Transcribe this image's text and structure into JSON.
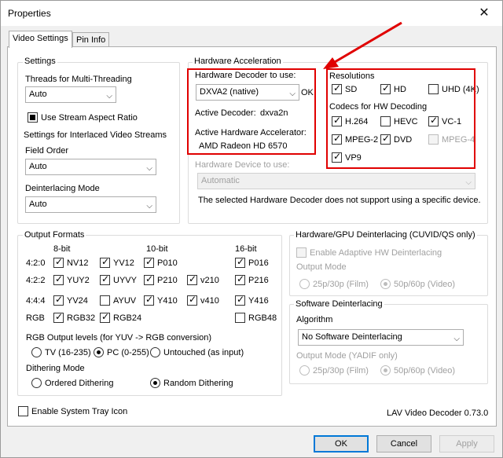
{
  "window": {
    "title": "Properties",
    "close_glyph": "✕"
  },
  "tabs": [
    "Video Settings",
    "Pin Info"
  ],
  "settings": {
    "group_label": "Settings",
    "threads_label": "Threads for Multi-Threading",
    "threads_value": "Auto",
    "stream_aspect_label": "Use Stream Aspect Ratio",
    "stream_aspect_state": "indeterminate",
    "interlaced_label": "Settings for Interlaced Video Streams",
    "field_order_label": "Field Order",
    "field_order_value": "Auto",
    "deint_mode_label": "Deinterlacing Mode",
    "deint_mode_value": "Auto"
  },
  "hwaccel": {
    "group_label": "Hardware Acceleration",
    "decoder_label": "Hardware Decoder to use:",
    "decoder_value": "DXVA2 (native)",
    "ok_label": "OK",
    "active_decoder_label": "Active Decoder:",
    "active_decoder_value": "dxva2n",
    "active_accel_label": "Active Hardware Accelerator:",
    "active_accel_value": "AMD Radeon HD 6570",
    "device_label": "Hardware Device to use:",
    "device_value": "Automatic",
    "device_note": "The selected Hardware Decoder does not support using a specific device.",
    "resolutions_label": "Resolutions",
    "resolutions": [
      {
        "label": "SD",
        "checked": true
      },
      {
        "label": "HD",
        "checked": true
      },
      {
        "label": "UHD (4K)",
        "checked": false
      }
    ],
    "codecs_label": "Codecs for HW Decoding",
    "codecs": [
      {
        "label": "H.264",
        "checked": true
      },
      {
        "label": "HEVC",
        "checked": false
      },
      {
        "label": "VC-1",
        "checked": true
      },
      {
        "label": "MPEG-2",
        "checked": true
      },
      {
        "label": "DVD",
        "checked": true
      },
      {
        "label": "MPEG-4",
        "checked": false,
        "disabled": true
      },
      {
        "label": "VP9",
        "checked": true
      }
    ]
  },
  "output_formats": {
    "group_label": "Output Formats",
    "col_8bit": "8-bit",
    "col_10bit": "10-bit",
    "col_16bit": "16-bit",
    "row_420": "4:2:0",
    "row_422": "4:2:2",
    "row_444": "4:4:4",
    "row_rgb": "RGB",
    "nv12": "NV12",
    "yv12": "YV12",
    "p010": "P010",
    "p016": "P016",
    "yuy2": "YUY2",
    "uyvy": "UYVY",
    "p210": "P210",
    "v210": "v210",
    "p216": "P216",
    "yv24": "YV24",
    "ayuv": "AYUV",
    "y410": "Y410",
    "v410": "v410",
    "y416": "Y416",
    "rgb32": "RGB32",
    "rgb24": "RGB24",
    "rgb48": "RGB48",
    "rgb_levels_label": "RGB Output levels (for YUV -> RGB conversion)",
    "levels": [
      "TV (16-235)",
      "PC (0-255)",
      "Untouched (as input)"
    ],
    "levels_selected": "PC (0-255)",
    "dither_label": "Dithering Mode",
    "dither": [
      "Ordered Dithering",
      "Random Dithering"
    ],
    "dither_selected": "Random Dithering"
  },
  "hw_deint": {
    "group_label": "Hardware/GPU Deinterlacing (CUVID/QS only)",
    "enable_label": "Enable Adaptive HW Deinterlacing",
    "output_mode_label": "Output Mode",
    "options": [
      "25p/30p (Film)",
      "50p/60p (Video)"
    ],
    "selected": "50p/60p (Video)"
  },
  "sw_deint": {
    "group_label": "Software Deinterlacing",
    "algorithm_label": "Algorithm",
    "algorithm_value": "No Software Deinterlacing",
    "output_mode_label": "Output Mode (YADIF only)",
    "options": [
      "25p/30p (Film)",
      "50p/60p (Video)"
    ],
    "selected": "50p/60p (Video)"
  },
  "tray_label": "Enable System Tray Icon",
  "version": "LAV Video Decoder 0.73.0",
  "buttons": {
    "ok": "OK",
    "cancel": "Cancel",
    "apply": "Apply"
  },
  "annotation": {
    "color": "#e00000"
  },
  "icons": {
    "check": "✓",
    "dropdown": "⌵"
  }
}
